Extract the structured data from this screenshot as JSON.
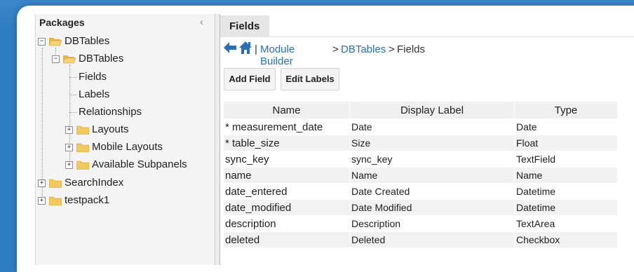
{
  "packages_panel": {
    "title": "Packages",
    "collapse_glyph": "‹"
  },
  "tree": {
    "items": [
      {
        "label": "DBTables",
        "type": "folder-open",
        "toggle": "−"
      },
      {
        "label": "DBTables",
        "type": "folder-open",
        "toggle": "−"
      },
      {
        "label": "Fields",
        "type": "leaf"
      },
      {
        "label": "Labels",
        "type": "leaf"
      },
      {
        "label": "Relationships",
        "type": "leaf"
      },
      {
        "label": "Layouts",
        "type": "folder",
        "toggle": "+"
      },
      {
        "label": "Mobile Layouts",
        "type": "folder",
        "toggle": "+"
      },
      {
        "label": "Available Subpanels",
        "type": "folder",
        "toggle": "+"
      },
      {
        "label": "SearchIndex",
        "type": "folder",
        "toggle": "+"
      },
      {
        "label": "testpack1",
        "type": "folder",
        "toggle": "+"
      }
    ]
  },
  "tab": {
    "label": "Fields"
  },
  "breadcrumb": {
    "separator": "|",
    "module_builder": "Module Builder",
    "gt1": ">",
    "dbtables": "DBTables",
    "gt2": ">",
    "current": "Fields"
  },
  "buttons": {
    "add_field": "Add Field",
    "edit_labels": "Edit Labels"
  },
  "table": {
    "headers": {
      "name": "Name",
      "display_label": "Display Label",
      "type": "Type"
    },
    "rows": [
      {
        "name": "* measurement_date",
        "label": "Date",
        "type": "Date"
      },
      {
        "name": "* table_size",
        "label": "Size",
        "type": "Float"
      },
      {
        "name": "sync_key",
        "label": "sync_key",
        "type": "TextField"
      },
      {
        "name": "name",
        "label": "Name",
        "type": "Name"
      },
      {
        "name": "date_entered",
        "label": "Date Created",
        "type": "Datetime"
      },
      {
        "name": "date_modified",
        "label": "Date Modified",
        "type": "Datetime"
      },
      {
        "name": "description",
        "label": "Description",
        "type": "TextArea"
      },
      {
        "name": "deleted",
        "label": "Deleted",
        "type": "Checkbox"
      }
    ]
  },
  "colors": {
    "background": "#2f7dc1",
    "link": "#2a6fb6",
    "folder": "#f3c85c"
  }
}
